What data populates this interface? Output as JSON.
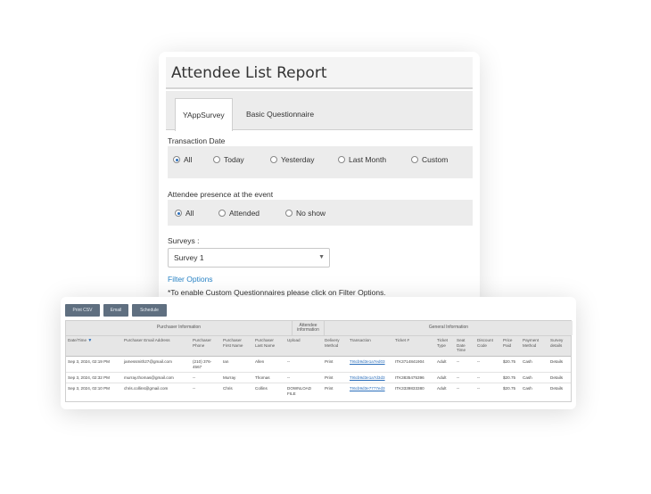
{
  "report": {
    "title": "Attendee List Report",
    "tabs": [
      {
        "label": "YAppSurvey",
        "active": true
      },
      {
        "label": "Basic Questionnaire",
        "active": false
      }
    ],
    "transaction_date": {
      "label": "Transaction Date",
      "options": [
        "All",
        "Today",
        "Yesterday",
        "Last Month",
        "Custom"
      ],
      "selected": "All"
    },
    "presence": {
      "label": "Attendee presence at the event",
      "options": [
        "All",
        "Attended",
        "No show"
      ],
      "selected": "All"
    },
    "surveys": {
      "label": "Surveys :",
      "selected": "Survey 1"
    },
    "filter_options_link": "Filter Options",
    "note": "*To enable Custom Questionnaires please click on Filter Options."
  },
  "table_card": {
    "buttons": [
      "Print CSV",
      "Email",
      "Schedule"
    ],
    "group_headers": [
      "Purchaser Information",
      "Attendee information",
      "General Information"
    ],
    "columns": [
      "Date/Time",
      "Purchaser Email Address",
      "Purchaser Phone",
      "Purchaser First Name",
      "Purchaser Last Name",
      "Upload",
      "Delivery Method",
      "Transaction",
      "Ticket #",
      "Ticket Type",
      "Seat Date Time",
      "Discount Code",
      "Price Paid",
      "Payment Method",
      "Survey details"
    ],
    "rows": [
      [
        "Sep 3, 2024, 02:19 PM",
        "jamessmith27@gmail.com",
        "(210) 376-4567",
        "Ian",
        "Allen",
        "--",
        "Print",
        "TI6cb9d3e1a7ed03",
        "ITK3714841904",
        "Adult",
        "--",
        "--",
        "$20.75",
        "Cash",
        "Details"
      ],
      [
        "Sep 3, 2024, 02:32 PM",
        "murray.thomas@gmail.com",
        "--",
        "Murray",
        "Thomas",
        "--",
        "Print",
        "TI6cb9d3e1a7d3d3",
        "ITK3835475396",
        "Adult",
        "--",
        "--",
        "$20.75",
        "Cash",
        "Details"
      ],
      [
        "Sep 3, 2024, 02:10 PM",
        "chris.collins@gmail.com",
        "--",
        "Chris",
        "Collins",
        "DOWNLOAD FILE",
        "Print",
        "TI6cb9d3e7777ed3",
        "ITK3339833380",
        "Adult",
        "--",
        "--",
        "$20.75",
        "Cash",
        "Details"
      ]
    ]
  },
  "colors": {
    "accent": "#2a6ebb",
    "link": "#2a84c6",
    "button_bg": "#5f6f80",
    "panel_bg": "#ececec"
  }
}
